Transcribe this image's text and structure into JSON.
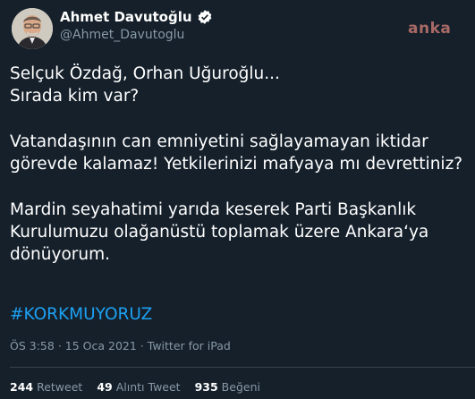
{
  "author": {
    "name": "Ahmet Davutoğlu",
    "handle": "@Ahmet_Davutoglu",
    "verified": true
  },
  "watermark": "anka",
  "tweet": {
    "paragraphs": [
      [
        "Selçuk Özdağ, Orhan Uğuroğlu...",
        "Sırada kim var?"
      ],
      [
        "Vatandaşının can emniyetini sağlayamayan iktidar",
        "görevde kalamaz! Yetkilerinizi mafyaya mı devrettiniz?"
      ],
      [
        "Mardin seyahatimi yarıda keserek Parti Başkanlık",
        "Kurulumuzu olağanüstü toplamak üzere Ankara‘ya",
        "dönüyorum."
      ]
    ],
    "hashtag": "#KORKMUYORUZ"
  },
  "meta": {
    "time": "ÖS 3:58",
    "date": "15 Oca 2021",
    "source": "Twitter for iPad"
  },
  "stats": {
    "retweets_count": "244",
    "retweets_label": "Retweet",
    "quotes_count": "49",
    "quotes_label": "Alıntı Tweet",
    "likes_count": "935",
    "likes_label": "Beğeni"
  },
  "colors": {
    "background": "#15202b",
    "link": "#1da1f2",
    "secondary_text": "#8899a6",
    "watermark": "#a96a66"
  }
}
